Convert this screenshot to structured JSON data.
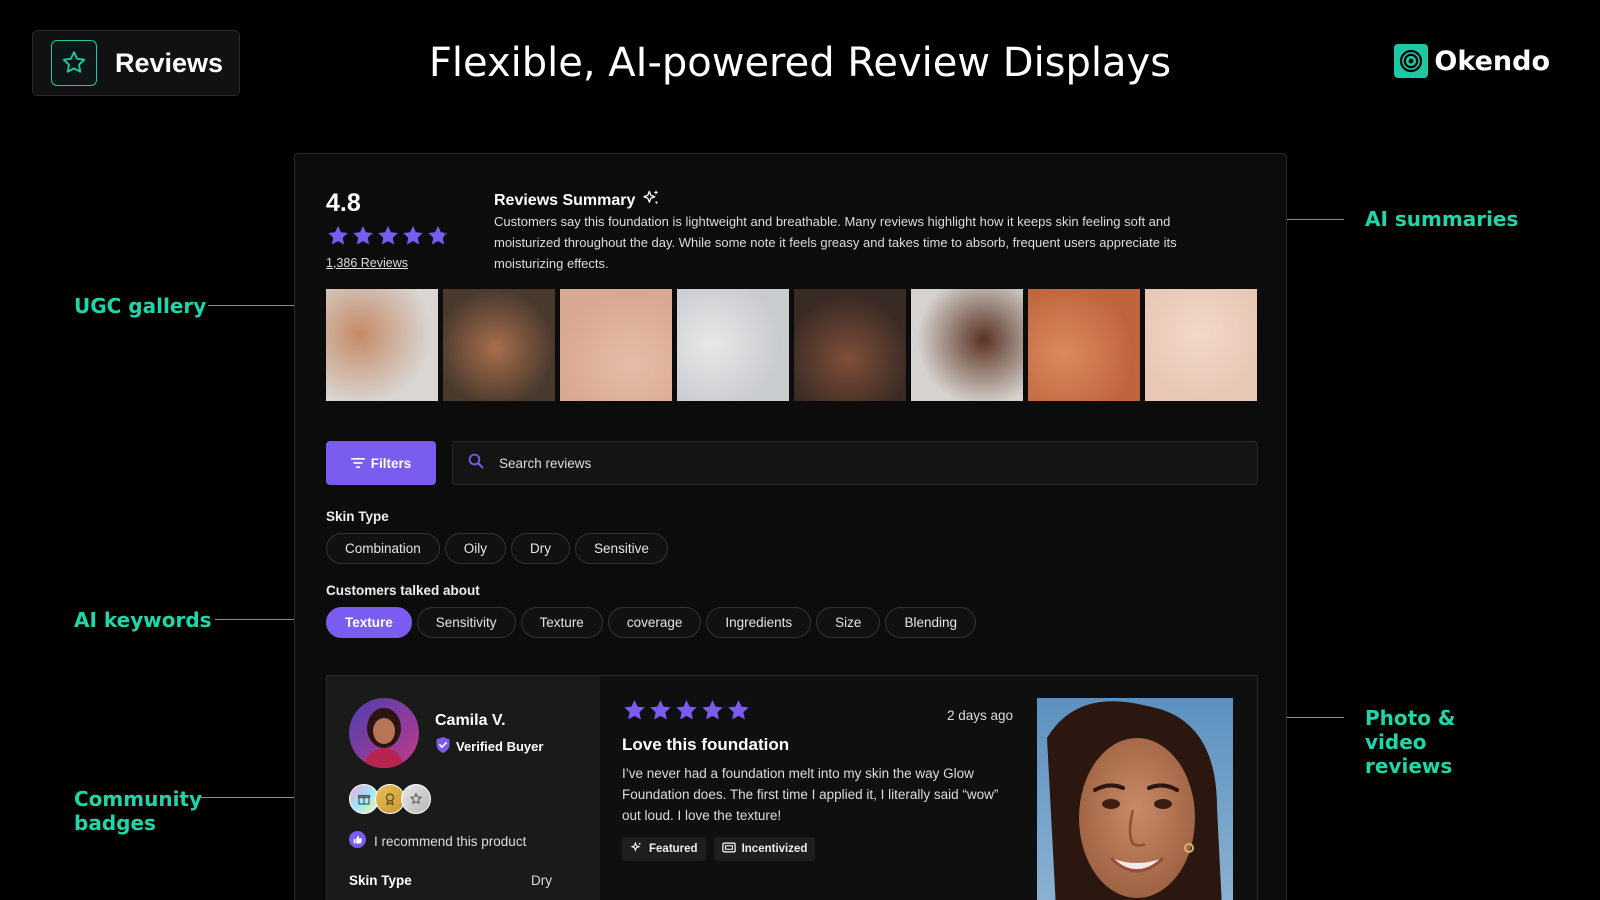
{
  "header": {
    "product_label": "Reviews",
    "headline": "Flexible, AI-powered Review Displays",
    "logo_text": "Okendo"
  },
  "callouts": {
    "ugc_gallery": "UGC gallery",
    "ai_keywords": "AI keywords",
    "community_badges": "Community badges",
    "ai_summaries": "AI summaries",
    "photo_video_reviews": "Photo & video reviews"
  },
  "summary": {
    "rating": "4.8",
    "stars": 4.8,
    "review_count": "1,386 Reviews",
    "title": "Reviews Summary",
    "text": "Customers say this foundation is lightweight and breathable. Many reviews highlight how it keeps skin feeling soft and moisturized throughout the day. While some note it feels greasy and takes time to absorb, frequent users appreciate its moisturizing effects."
  },
  "gallery": [
    {
      "name": "gallery-photo-hand-dropper-bottle",
      "bg": "#d9d6d3",
      "accent": "#c48a66"
    },
    {
      "name": "gallery-photo-smiling-woman",
      "bg": "#4a3a2e",
      "accent": "#a86f4c"
    },
    {
      "name": "gallery-photo-skin-closeup",
      "bg": "#d8a891",
      "accent": "#e6bca6"
    },
    {
      "name": "gallery-photo-dropper-serum",
      "bg": "#c9ccce",
      "accent": "#e5e7e8"
    },
    {
      "name": "gallery-photo-profile-woman",
      "bg": "#3a2a24",
      "accent": "#7e4f3a"
    },
    {
      "name": "gallery-photo-hands-bottle",
      "bg": "#d6d2cf",
      "accent": "#5a3322"
    },
    {
      "name": "gallery-photo-eye-closeup",
      "bg": "#c0643e",
      "accent": "#d98a5c"
    },
    {
      "name": "gallery-photo-face-dropper",
      "bg": "#e8c7b5",
      "accent": "#f1d8c9"
    }
  ],
  "controls": {
    "filters_label": "Filters",
    "search_placeholder": "Search reviews"
  },
  "skin_type": {
    "label": "Skin Type",
    "chips": [
      "Combination",
      "Oily",
      "Dry",
      "Sensitive"
    ]
  },
  "keywords": {
    "label": "Customers talked about",
    "chips": [
      "Texture",
      "Sensitivity",
      "Texture",
      "coverage",
      "Ingredients",
      "Size",
      "Blending"
    ],
    "active_index": 0
  },
  "review": {
    "name": "Camila V.",
    "verified": "Verified Buyer",
    "stars": 5,
    "date": "2 days ago",
    "title": "Love this foundation",
    "body": "I’ve never had a foundation melt into my skin the way Glow Foundation does. The first time I applied it, I literally said “wow” out loud. I love the texture!",
    "recommend": "I recommend this product",
    "tags": [
      "Featured",
      "Incentivized"
    ],
    "attribute_label": "Skin Type",
    "attribute_value": "Dry",
    "badges": [
      "gift-badge-icon",
      "medal-badge-icon",
      "star-badge-icon"
    ]
  },
  "colors": {
    "accent_purple": "#7b5cf0",
    "brand_teal": "#1ec8a5",
    "callout_green": "#20d6a8"
  }
}
